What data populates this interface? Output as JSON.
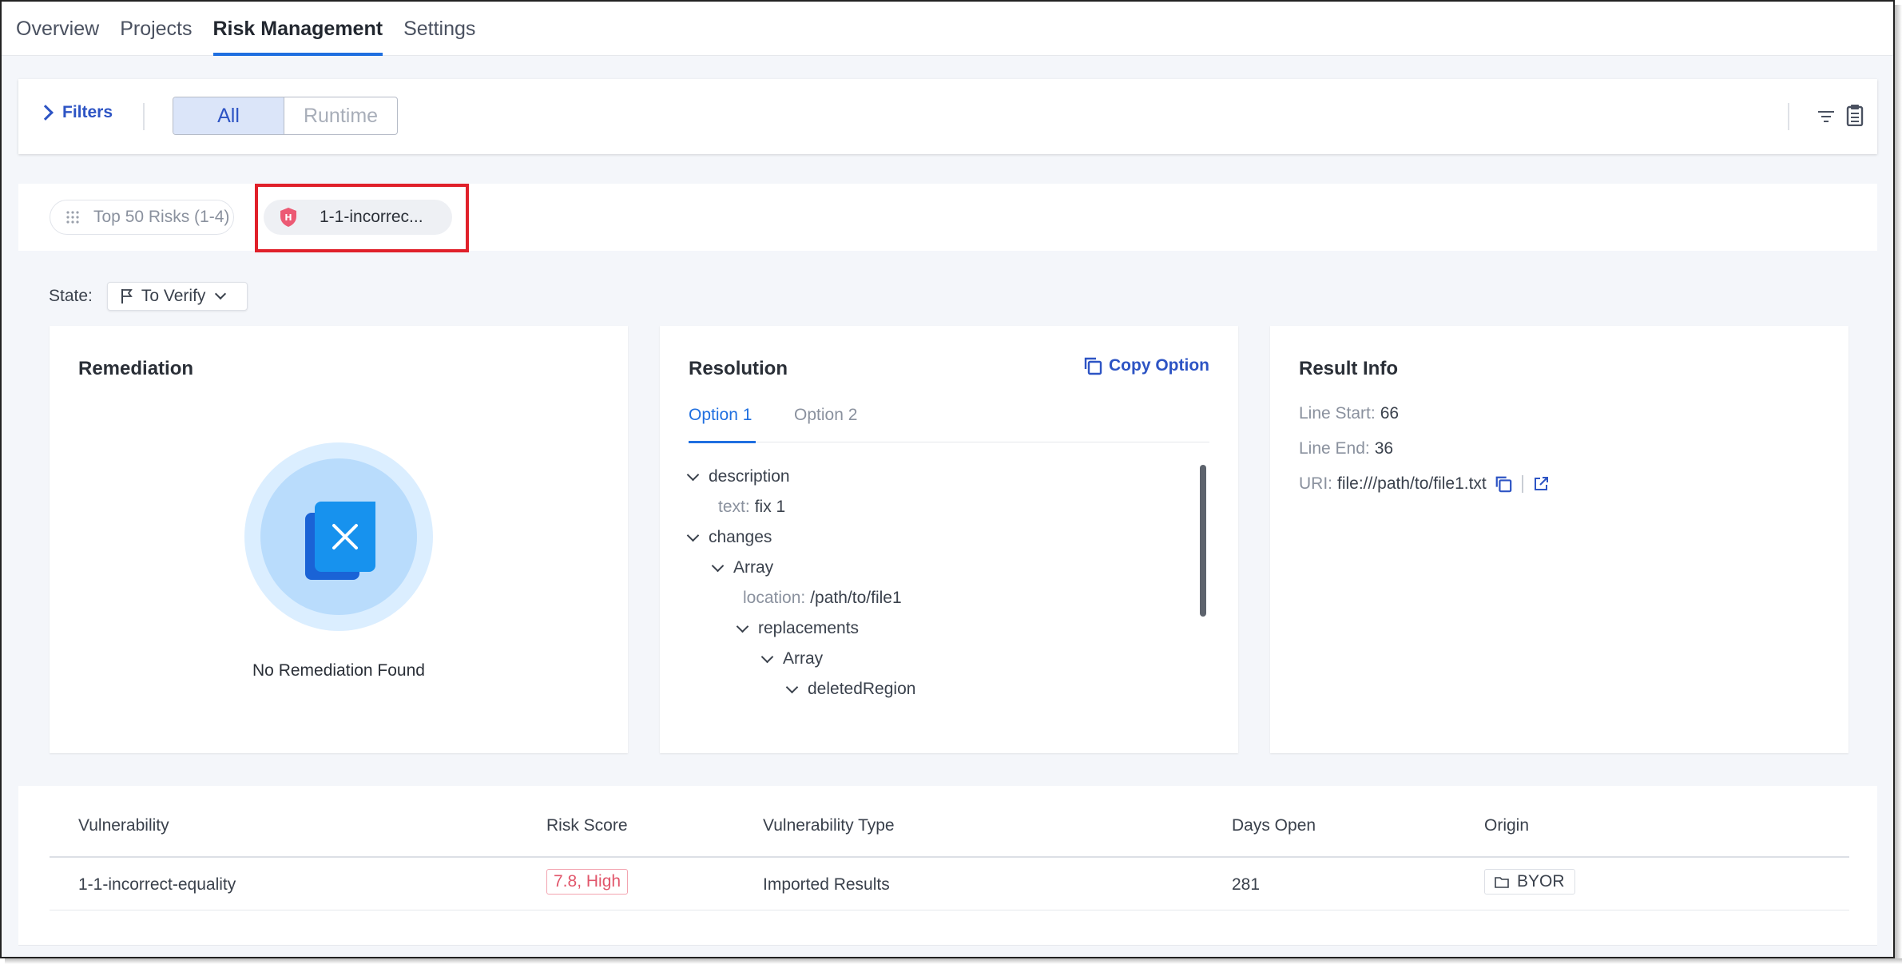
{
  "nav": {
    "tabs": [
      {
        "label": "Overview"
      },
      {
        "label": "Projects"
      },
      {
        "label": "Risk Management"
      },
      {
        "label": "Settings"
      }
    ],
    "active_index": 2
  },
  "filters": {
    "label": "Filters",
    "segments": [
      "All",
      "Runtime"
    ],
    "active_segment": "All"
  },
  "risk_tabs": {
    "list_tab": "Top 50 Risks (1-4)",
    "detail_tab": "1-1-incorrec...",
    "detail_badge": "H"
  },
  "state": {
    "label": "State:",
    "value": "To Verify"
  },
  "remediation": {
    "title": "Remediation",
    "empty_message": "No Remediation Found"
  },
  "resolution": {
    "title": "Resolution",
    "copy_label": "Copy Option",
    "options": [
      "Option 1",
      "Option 2"
    ],
    "tree": [
      {
        "type": "node",
        "label": "description",
        "indent": 0
      },
      {
        "type": "leaf",
        "key": "text:",
        "value": "fix 1",
        "indent": 1
      },
      {
        "type": "node",
        "label": "changes",
        "indent": 0
      },
      {
        "type": "node",
        "label": "Array",
        "indent": 1
      },
      {
        "type": "leaf",
        "key": "location:",
        "value": "/path/to/file1",
        "indent": 2
      },
      {
        "type": "node",
        "label": "replacements",
        "indent": 2
      },
      {
        "type": "node",
        "label": "Array",
        "indent": 3
      },
      {
        "type": "node",
        "label": "deletedRegion",
        "indent": 4
      }
    ]
  },
  "result_info": {
    "title": "Result Info",
    "line_start_label": "Line Start:",
    "line_start": "66",
    "line_end_label": "Line End:",
    "line_end": "36",
    "uri_label": "URI:",
    "uri": "file:///path/to/file1.txt"
  },
  "table": {
    "headers": [
      "Vulnerability",
      "Risk Score",
      "Vulnerability Type",
      "Days Open",
      "Origin"
    ],
    "rows": [
      {
        "vulnerability": "1-1-incorrect-equality",
        "risk_score": "7.8, High",
        "type": "Imported Results",
        "days_open": "281",
        "origin": "BYOR"
      }
    ]
  },
  "colors": {
    "accent": "#1f6fe0",
    "link": "#2d54c4",
    "high_risk": "#e1566b",
    "highlight_box": "#e0202a"
  },
  "icons": {
    "filters_chevron": "chevron-right-icon",
    "filter_lines": "filter-icon",
    "clipboard": "clipboard-icon",
    "grid": "grid-icon",
    "shield": "shield-icon",
    "flag": "flag-icon",
    "copy": "copy-icon",
    "external": "external-link-icon",
    "folder": "folder-icon"
  }
}
